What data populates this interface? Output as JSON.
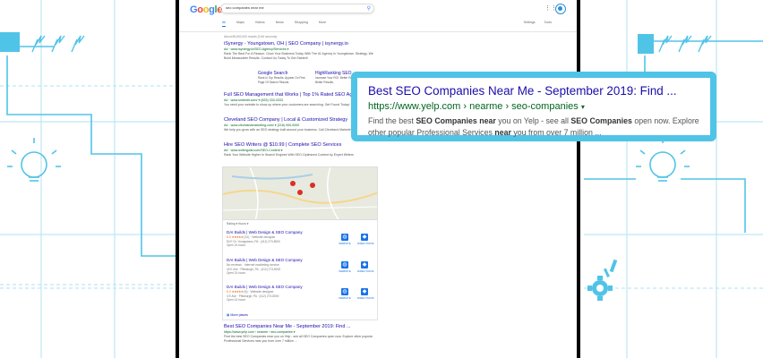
{
  "colors": {
    "accent": "#50c4e7",
    "link": "#1a0dab",
    "url": "#006621",
    "text": "#545454"
  },
  "google": {
    "logo": [
      "G",
      "o",
      "o",
      "g",
      "l",
      "e"
    ],
    "logo_colors": [
      "#4285f4",
      "#ea4335",
      "#fbbc05",
      "#4285f4",
      "#34a853",
      "#ea4335"
    ],
    "query": "seo companies near me",
    "tabs": [
      "All",
      "Maps",
      "Videos",
      "News",
      "Shopping",
      "More"
    ],
    "tools": [
      "Settings",
      "Tools"
    ],
    "results_count": "About 86,800,000 results (0.66 seconds)"
  },
  "results": [
    {
      "title": "iSynergy - Youngstown, OH | SEO Company | isynergy.io",
      "url": "Ad · www.isynergy.io/SEO-Agency/Services ▾",
      "desc": "Rank The Best For A Reason. Grow Your Business Today With The #1 Agency In Youngstown. Strategy, We Build Measurable Results. Contact Us Today To Get Started!"
    },
    {
      "title": "Full SEO Management that Works | Top 1% Rated SEO Agency",
      "url": "Ad · www.smbedit.com/ ▾ (833) 333-3333",
      "desc": "You need your website to show up where your customers are searching. Get Found Today!"
    },
    {
      "title": "Cleveland SEO Company | Local & Customized Strategy",
      "url": "Ad · www.clevelandmarketing.com/ ▾ (216) 000-0000",
      "desc": "We help you grow with an SEO strategy built around your business. Call Cleveland Marketing Today!"
    },
    {
      "title": "Hire SEO Writers @ $10.99 | Complete SEO Services",
      "url": "Ad · www.writerguild.com/SEO-Content ▾",
      "desc": "Rank Your Website Higher In Search Engines With SEO-Optimized Content by Expert Writers"
    }
  ],
  "sitelinks": [
    {
      "title": "Google Search",
      "desc": "Rank In Top Results. Appear On First Page Of Search Results."
    },
    {
      "title": "HighRanking SEO",
      "desc": "Increase Your ROI. Better Rankings, Better Results."
    }
  ],
  "local": {
    "filters": "Rating ▾    Hours ▾",
    "businesses": [
      {
        "name": "DAI Builds | Web Design & SEO Company",
        "rating": "5.0",
        "stars": "★★★★★",
        "reviews": "(31) · Website designer",
        "meta": "50 E Dr, Youngstown, PA · (412) 273-8000\nOpen 24 hours",
        "actions": [
          "WEBSITE",
          "DIRECTIONS"
        ]
      },
      {
        "name": "DAI Builds | Web Design & SEO Company",
        "rating": "",
        "stars": "",
        "reviews": "No reviews · Internet marketing service",
        "meta": "40 E Ave · Pittsburgh, PA · (412) 273-8000\nOpen 24 hours",
        "actions": [
          "WEBSITE",
          "DIRECTIONS"
        ]
      },
      {
        "name": "DAI Builds | Web Design & SEO Company",
        "rating": "5.0",
        "stars": "★★★★★",
        "reviews": "(5) · Website designer",
        "meta": "3 E Ave · Pittsburgh, PA · (412) 273-8000\nOpen 24 hours",
        "actions": [
          "WEBSITE",
          "DIRECTIONS"
        ]
      }
    ],
    "more": "More places"
  },
  "bottom_result": {
    "title": "Best SEO Companies Near Me - September 2019: Find ...",
    "url": "https://www.yelp.com › nearme › seo-companies ▾",
    "desc": "Find the best SEO Companies near you on Yelp - see all SEO Companies open now. Explore other popular Professional Services near you from over 7 million ..."
  },
  "callout": {
    "title": "Best SEO Companies Near Me - September 2019: Find ...",
    "url": "https://www.yelp.com › nearme › seo-companies",
    "url_caret": "▾",
    "desc": [
      {
        "t": "Find the best ",
        "b": false
      },
      {
        "t": "SEO Companies near",
        "b": true
      },
      {
        "t": " you on Yelp - see all ",
        "b": false
      },
      {
        "t": "SEO Companies",
        "b": true
      },
      {
        "t": " open now. Explore other popular Professional Services ",
        "b": false
      },
      {
        "t": "near",
        "b": true
      },
      {
        "t": " you from over 7 million ...",
        "b": false
      }
    ]
  }
}
